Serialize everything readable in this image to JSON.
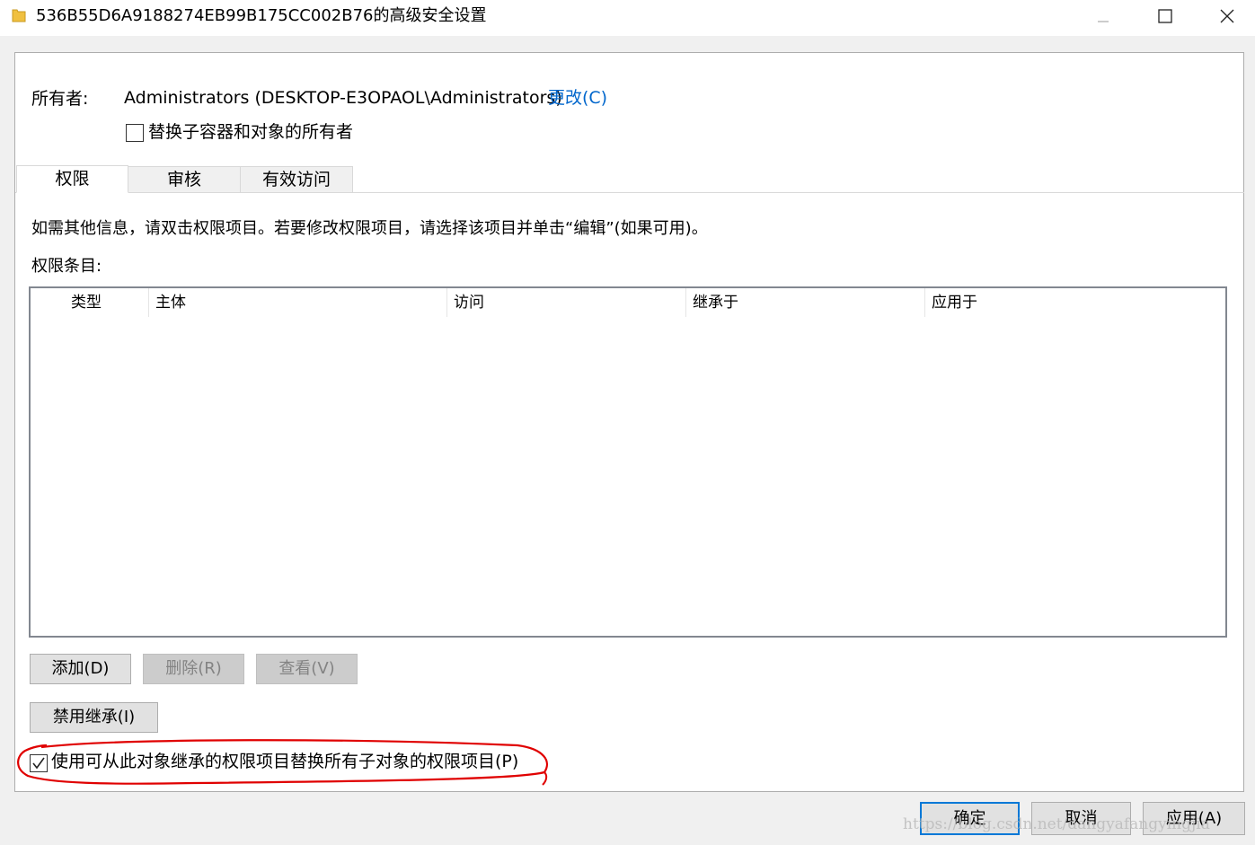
{
  "window": {
    "title": "536B55D6A9188274EB99B175CC002B76的高级安全设置",
    "controls": [
      "minimize",
      "maximize",
      "close"
    ]
  },
  "owner": {
    "label": "所有者:",
    "value": "Administrators (DESKTOP-E3OPAOL\\Administrators)",
    "change_link": "更改(C)",
    "replace_checkbox_label": "替换子容器和对象的所有者",
    "replace_checked": false
  },
  "tabs": [
    {
      "label": "权限",
      "active": true
    },
    {
      "label": "审核",
      "active": false
    },
    {
      "label": "有效访问",
      "active": false
    }
  ],
  "permissions": {
    "info": "如需其他信息，请双击权限项目。若要修改权限项目，请选择该项目并单击“编辑”(如果可用)。",
    "entries_label": "权限条目:",
    "columns": [
      "类型",
      "主体",
      "访问",
      "继承于",
      "应用于"
    ],
    "rows": []
  },
  "actions": {
    "add": "添加(D)",
    "remove": "删除(R)",
    "view": "查看(V)",
    "disable_inheritance": "禁用继承(I)"
  },
  "inherit_checkbox": {
    "label": "使用可从此对象继承的权限项目替换所有子对象的权限项目(P)",
    "checked": true
  },
  "footer": {
    "ok": "确定",
    "cancel": "取消",
    "apply": "应用(A)"
  },
  "watermark": "https://blog.csdn.net/dangyafangyingjia",
  "colors": {
    "link": "#0066cc",
    "accent": "#0078d7",
    "annotation": "#e00000"
  }
}
